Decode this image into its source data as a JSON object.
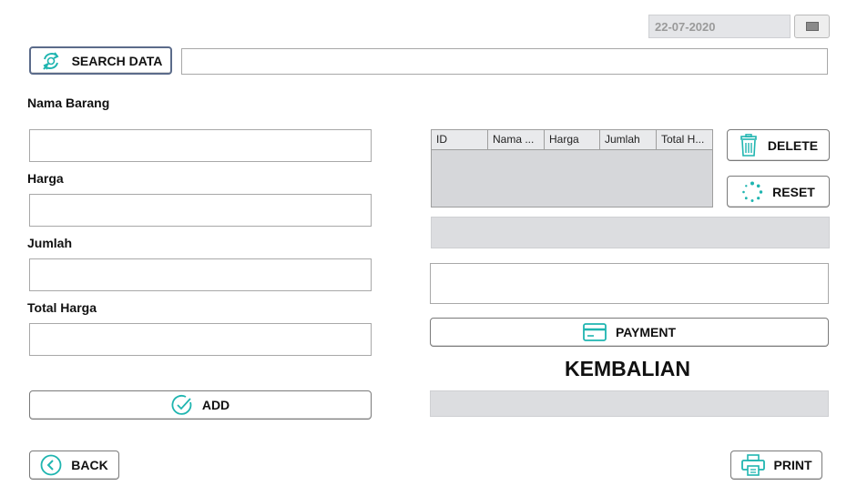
{
  "date": {
    "value": "22-07-2020"
  },
  "search": {
    "button_label": "SEARCH DATA",
    "input_value": ""
  },
  "form": {
    "nama_barang_label": "Nama Barang",
    "harga_label": "Harga",
    "jumlah_label": "Jumlah",
    "total_harga_label": "Total Harga",
    "add_label": "ADD"
  },
  "table": {
    "columns": [
      "ID",
      "Nama ...",
      "Harga",
      "Jumlah",
      "Total H..."
    ]
  },
  "actions": {
    "delete_label": "DELETE",
    "reset_label": "RESET",
    "payment_label": "PAYMENT",
    "kembalian_label": "KEMBALIAN",
    "back_label": "BACK",
    "print_label": "PRINT"
  },
  "colors": {
    "icon_accent": "#1fb5b0"
  }
}
